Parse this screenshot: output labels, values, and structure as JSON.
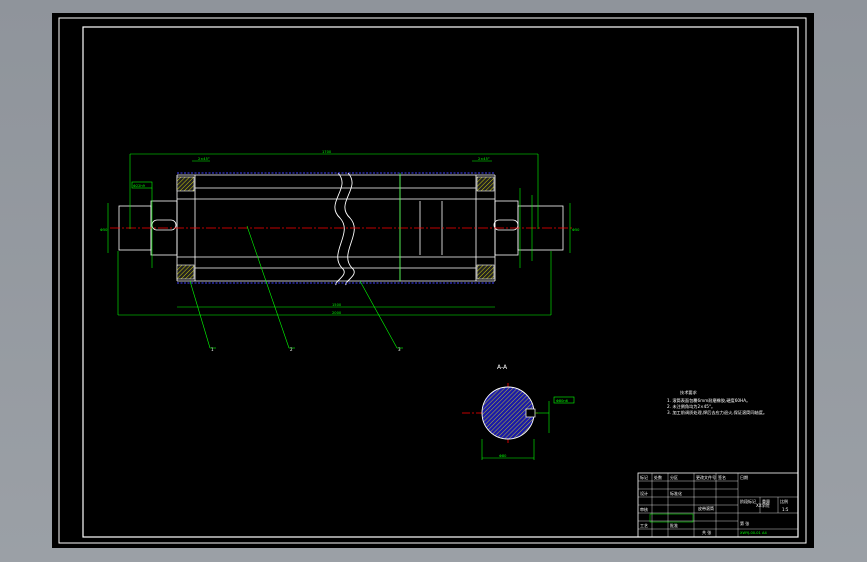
{
  "section_label": "A-A",
  "leaders": [
    "1",
    "2",
    "3"
  ],
  "dims": {
    "overall": "1700",
    "total_lower": "2000",
    "body_lower": "1500",
    "left_top": "2×45°",
    "right_top": "2×45°",
    "left_box": "Φ22h9",
    "section_dia": "Φ80",
    "section_box": "Φ80n6",
    "left_shaft": "Φ50",
    "right_shaft": "Φ50"
  },
  "notes": {
    "title": "技术要求",
    "lines": [
      "1. 滚筒表面包覆6mm耐磨橡胶,硬度60HA。",
      "2. 未注倒角均为2×45°。",
      "3. 加工前调质处理,焊后去应力退火,保证滚筒同轴度。"
    ]
  },
  "title_block": {
    "part_name": "皮带滚筒",
    "unit": "XX学院",
    "drawing_number": "XWYJ-00-01 A4",
    "rows": [
      [
        "标记",
        "处数",
        "分区",
        "更改文件号",
        "签名",
        "日期"
      ],
      [
        "设计",
        "",
        "标准化",
        "",
        "阶段标记",
        "重量",
        "比例"
      ],
      [
        "审核",
        "",
        "",
        "",
        "",
        "",
        "1:5"
      ],
      [
        "工艺",
        "",
        "批准",
        "",
        "共 张",
        "第 张"
      ]
    ]
  },
  "colors": {
    "viewport": "#000000",
    "border": "#ffffff",
    "dimension": "#00ff00",
    "centerline": "#ff0000",
    "hidden": "#4040ff",
    "section_fill": "#1a1aa8",
    "hatch": "#ffff00"
  }
}
